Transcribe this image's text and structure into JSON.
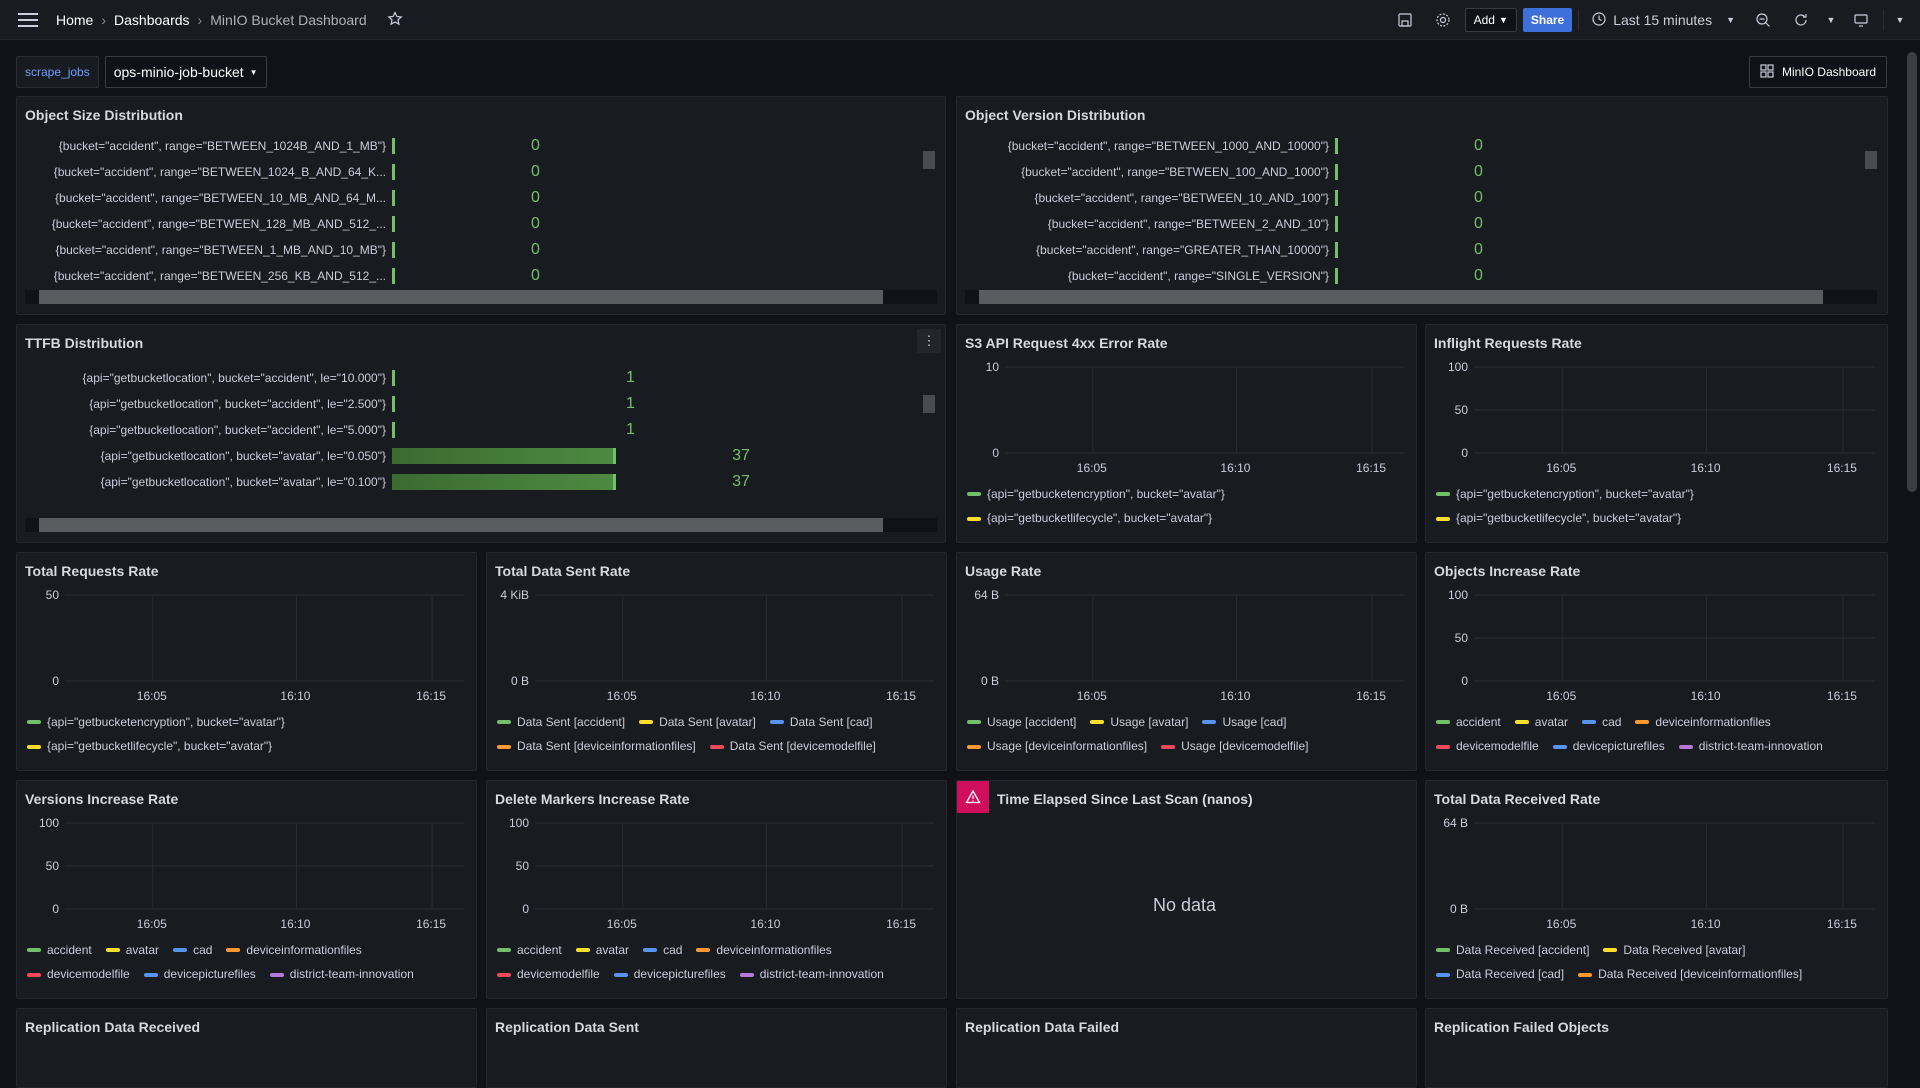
{
  "nav": {
    "home": "Home",
    "dashboards": "Dashboards",
    "current": "MinIO Bucket Dashboard"
  },
  "toolbar": {
    "add_label": "Add",
    "share_label": "Share",
    "time_range": "Last 15 minutes"
  },
  "variables": {
    "label": "scrape_jobs",
    "value": "ops-minio-job-bucket"
  },
  "dash_link": "MinIO Dashboard",
  "colors": {
    "green": "#73bf69",
    "yellow": "#fade2a",
    "blue": "#5794f2",
    "orange": "#ff9830",
    "red": "#f2495c",
    "purple": "#b877d9",
    "accent": "#3d71d9",
    "warn": "#d10e5c"
  },
  "panels": {
    "object_size": {
      "title": "Object Size Distribution",
      "rows": [
        {
          "label": "{bucket=\"accident\", range=\"BETWEEN_1024B_AND_1_MB\"}",
          "value": "0"
        },
        {
          "label": "{bucket=\"accident\", range=\"BETWEEN_1024_B_AND_64_K...",
          "value": "0"
        },
        {
          "label": "{bucket=\"accident\", range=\"BETWEEN_10_MB_AND_64_M...",
          "value": "0"
        },
        {
          "label": "{bucket=\"accident\", range=\"BETWEEN_128_MB_AND_512_...",
          "value": "0"
        },
        {
          "label": "{bucket=\"accident\", range=\"BETWEEN_1_MB_AND_10_MB\"}",
          "value": "0"
        },
        {
          "label": "{bucket=\"accident\", range=\"BETWEEN_256_KB_AND_512_...",
          "value": "0"
        }
      ]
    },
    "object_version": {
      "title": "Object Version Distribution",
      "rows": [
        {
          "label": "{bucket=\"accident\", range=\"BETWEEN_1000_AND_10000\"}",
          "value": "0"
        },
        {
          "label": "{bucket=\"accident\", range=\"BETWEEN_100_AND_1000\"}",
          "value": "0"
        },
        {
          "label": "{bucket=\"accident\", range=\"BETWEEN_10_AND_100\"}",
          "value": "0"
        },
        {
          "label": "{bucket=\"accident\", range=\"BETWEEN_2_AND_10\"}",
          "value": "0"
        },
        {
          "label": "{bucket=\"accident\", range=\"GREATER_THAN_10000\"}",
          "value": "0"
        },
        {
          "label": "{bucket=\"accident\", range=\"SINGLE_VERSION\"}",
          "value": "0"
        }
      ]
    },
    "ttfb": {
      "title": "TTFB Distribution",
      "rows": [
        {
          "label": "{api=\"getbucketlocation\", bucket=\"accident\", le=\"10.000\"}",
          "value": "1",
          "fill": 0.01
        },
        {
          "label": "{api=\"getbucketlocation\", bucket=\"accident\", le=\"2.500\"}",
          "value": "1",
          "fill": 0.01
        },
        {
          "label": "{api=\"getbucketlocation\", bucket=\"accident\", le=\"5.000\"}",
          "value": "1",
          "fill": 0.01
        },
        {
          "label": "{api=\"getbucketlocation\", bucket=\"avatar\", le=\"0.050\"}",
          "value": "37",
          "fill": 1
        },
        {
          "label": "{api=\"getbucketlocation\", bucket=\"avatar\", le=\"0.100\"}",
          "value": "37",
          "fill": 1
        }
      ]
    },
    "s3_4xx": {
      "title": "S3 API Request 4xx Error Rate",
      "y_ticks": [
        "10",
        "0"
      ],
      "x_ticks": [
        "16:05",
        "16:10",
        "16:15"
      ],
      "legend": [
        "{api=\"getbucketencryption\", bucket=\"avatar\"}",
        "{api=\"getbucketlifecycle\", bucket=\"avatar\"}"
      ]
    },
    "inflight": {
      "title": "Inflight Requests Rate",
      "y_ticks": [
        "100",
        "50",
        "0"
      ],
      "x_ticks": [
        "16:05",
        "16:10",
        "16:15"
      ],
      "legend": [
        "{api=\"getbucketencryption\", bucket=\"avatar\"}",
        "{api=\"getbucketlifecycle\", bucket=\"avatar\"}"
      ]
    },
    "total_requests": {
      "title": "Total Requests Rate",
      "y_ticks": [
        "50",
        "0"
      ],
      "x_ticks": [
        "16:05",
        "16:10",
        "16:15"
      ],
      "legend": [
        "{api=\"getbucketencryption\", bucket=\"avatar\"}",
        "{api=\"getbucketlifecycle\", bucket=\"avatar\"}"
      ]
    },
    "data_sent": {
      "title": "Total Data Sent Rate",
      "y_ticks": [
        "4 KiB",
        "0 B"
      ],
      "x_ticks": [
        "16:05",
        "16:10",
        "16:15"
      ],
      "legend": [
        "Data Sent [accident]",
        "Data Sent [avatar]",
        "Data Sent [cad]",
        "Data Sent [deviceinformationfiles]",
        "Data Sent [devicemodelfile]"
      ]
    },
    "usage": {
      "title": "Usage Rate",
      "y_ticks": [
        "64 B",
        "0 B"
      ],
      "x_ticks": [
        "16:05",
        "16:10",
        "16:15"
      ],
      "legend": [
        "Usage [accident]",
        "Usage [avatar]",
        "Usage [cad]",
        "Usage [deviceinformationfiles]",
        "Usage [devicemodelfile]"
      ]
    },
    "objects_inc": {
      "title": "Objects Increase Rate",
      "y_ticks": [
        "100",
        "50",
        "0"
      ],
      "x_ticks": [
        "16:05",
        "16:10",
        "16:15"
      ],
      "legend": [
        "accident",
        "avatar",
        "cad",
        "deviceinformationfiles",
        "devicemodelfile",
        "devicepicturefiles",
        "district-team-innovation"
      ]
    },
    "versions_inc": {
      "title": "Versions Increase Rate",
      "y_ticks": [
        "100",
        "50",
        "0"
      ],
      "x_ticks": [
        "16:05",
        "16:10",
        "16:15"
      ],
      "legend": [
        "accident",
        "avatar",
        "cad",
        "deviceinformationfiles",
        "devicemodelfile",
        "devicepicturefiles",
        "district-team-innovation"
      ]
    },
    "delete_markers": {
      "title": "Delete Markers Increase Rate",
      "y_ticks": [
        "100",
        "50",
        "0"
      ],
      "x_ticks": [
        "16:05",
        "16:10",
        "16:15"
      ],
      "legend": [
        "accident",
        "avatar",
        "cad",
        "deviceinformationfiles",
        "devicemodelfile",
        "devicepicturefiles",
        "district-team-innovation"
      ]
    },
    "time_elapsed": {
      "title": "Time Elapsed Since Last Scan (nanos)",
      "no_data": "No data"
    },
    "data_received": {
      "title": "Total Data Received Rate",
      "y_ticks": [
        "64 B",
        "0 B"
      ],
      "x_ticks": [
        "16:05",
        "16:10",
        "16:15"
      ],
      "legend": [
        "Data Received [accident]",
        "Data Received [avatar]",
        "Data Received [cad]",
        "Data Received [deviceinformationfiles]"
      ]
    },
    "repl_received": {
      "title": "Replication Data Received"
    },
    "repl_sent": {
      "title": "Replication Data Sent"
    },
    "repl_failed": {
      "title": "Replication Data Failed"
    },
    "repl_failed_objects": {
      "title": "Replication Failed Objects"
    }
  }
}
